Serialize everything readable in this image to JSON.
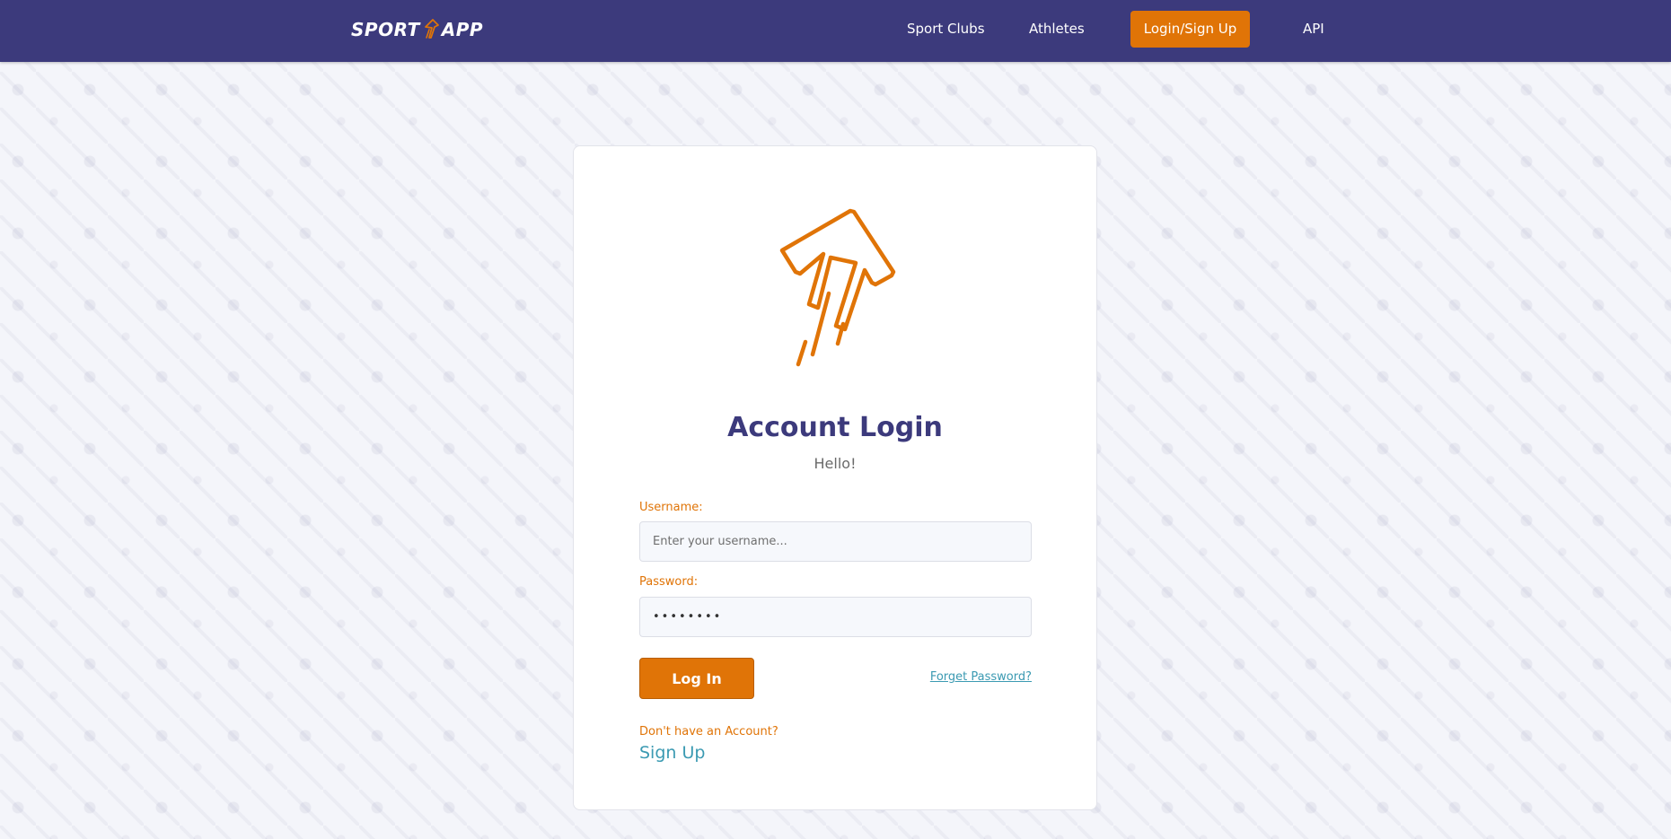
{
  "navbar": {
    "brand_left": "SPORT",
    "brand_right": "APP",
    "items": [
      {
        "label": "Sport Clubs"
      },
      {
        "label": "Athletes"
      },
      {
        "label": "Login/Sign Up",
        "active": true
      },
      {
        "label": "API"
      }
    ]
  },
  "login": {
    "title": "Account Login",
    "subtitle": "Hello!",
    "username_label": "Username:",
    "username_placeholder": "Enter your username...",
    "password_label": "Password:",
    "password_value": "••••••••",
    "login_button": "Log In",
    "forgot_link": "Forget Password?",
    "no_account_text": "Don't have an Account?",
    "signup_link": "Sign Up"
  },
  "icons": {
    "brand_icon": "arrow-up-right-icon",
    "logo_icon": "arrow-up-right-icon"
  },
  "colors": {
    "navbar": "#3c3a7c",
    "accent": "#e07407",
    "title": "#3c3a7c",
    "link": "#3b9ab2"
  }
}
